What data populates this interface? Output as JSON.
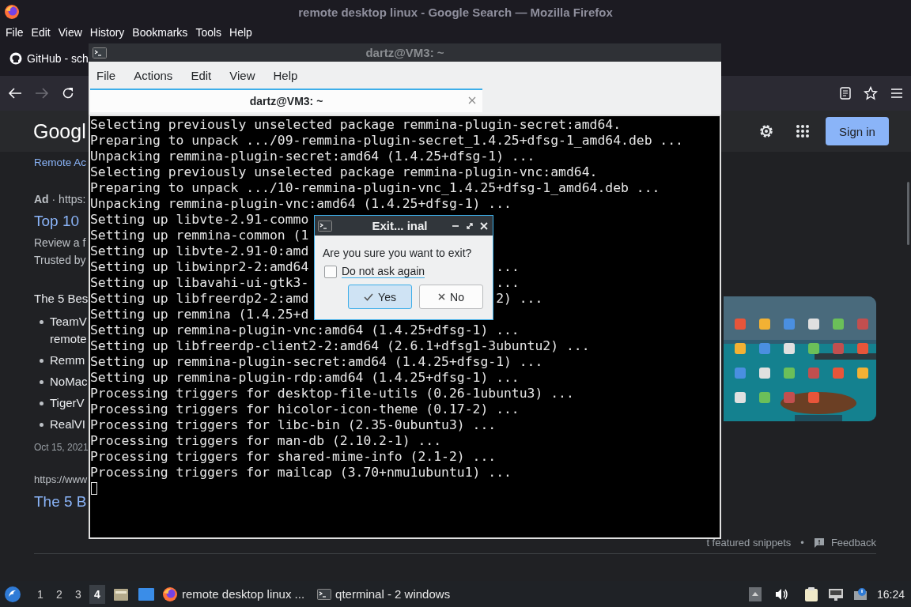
{
  "firefox": {
    "title": "remote desktop linux - Google Search — Mozilla Firefox",
    "menu": [
      "File",
      "Edit",
      "View",
      "History",
      "Bookmarks",
      "Tools",
      "Help"
    ],
    "tabs": [
      {
        "label": "GitHub - sch"
      }
    ],
    "nav": {
      "forward_disabled": true
    }
  },
  "google": {
    "logo": "Googl",
    "sign_in": "Sign in",
    "results": [
      {
        "kind": "link",
        "text": "Remote Ac"
      },
      {
        "kind": "ad",
        "text": "**Ad** · https:"
      },
      {
        "kind": "title",
        "text": "Top 10"
      },
      {
        "kind": "snippet",
        "text": "Review a f"
      },
      {
        "kind": "snippet",
        "text": "Trusted by"
      },
      {
        "kind": "heading",
        "text": "The 5 Bes"
      },
      {
        "kind": "bullet",
        "lines": [
          "TeamV",
          "remote"
        ]
      },
      {
        "kind": "bullet",
        "lines": [
          "Remm"
        ]
      },
      {
        "kind": "bullet",
        "lines": [
          "NoMac"
        ]
      },
      {
        "kind": "bullet",
        "lines": [
          "TigerV"
        ]
      },
      {
        "kind": "bullet",
        "lines": [
          "RealVI"
        ]
      },
      {
        "kind": "date",
        "text": "Oct 15, 2021"
      },
      {
        "kind": "url",
        "text": "https://www"
      },
      {
        "kind": "title",
        "text": "The 5 B"
      }
    ],
    "footer": {
      "snippets": "t featured snippets",
      "separator": "•",
      "feedback": "Feedback"
    }
  },
  "terminal": {
    "title": "dartz@VM3: ~",
    "menu": [
      "File",
      "Actions",
      "Edit",
      "View",
      "Help"
    ],
    "tab": "dartz@VM3: ~",
    "lines": [
      {
        "text": "Selecting previously unselected package remmina-plugin-secret:amd64."
      },
      {
        "text": "Preparing to unpack .../09-remmina-plugin-secret_1.4.25+dfsg-1_amd64.deb ..."
      },
      {
        "text": "Unpacking remmina-plugin-secret:amd64 (1.4.25+dfsg-1) ..."
      },
      {
        "text": "Selecting previously unselected package remmina-plugin-vnc:amd64."
      },
      {
        "text": "Preparing to unpack .../10-remmina-plugin-vnc_1.4.25+dfsg-1_amd64.deb ..."
      },
      {
        "text": "Unpacking remmina-plugin-vnc:amd64 (1.4.25+dfsg-1) ..."
      },
      {
        "text": "Setting up libvte-2.91-commo"
      },
      {
        "text": "Setting up remmina-common (1"
      },
      {
        "text": "Setting up libvte-2.91-0:amd"
      },
      {
        "text": "Setting up libwinpr2-2:amd64",
        "tail": "..."
      },
      {
        "text": "Setting up libavahi-ui-gtk3-",
        "tail": "..."
      },
      {
        "text": "Setting up libfreerdp2-2:amd",
        "tail": "2) ..."
      },
      {
        "text": "Setting up remmina (1.4.25+d"
      },
      {
        "text": "Setting up remmina-plugin-vnc:amd64 (1.4.25+dfsg-1) ..."
      },
      {
        "text": "Setting up libfreerdp-client2-2:amd64 (2.6.1+dfsg1-3ubuntu2) ..."
      },
      {
        "text": "Setting up remmina-plugin-secret:amd64 (1.4.25+dfsg-1) ..."
      },
      {
        "text": "Setting up remmina-plugin-rdp:amd64 (1.4.25+dfsg-1) ..."
      },
      {
        "text": "Processing triggers for desktop-file-utils (0.26-1ubuntu3) ..."
      },
      {
        "text": "Processing triggers for hicolor-icon-theme (0.17-2) ..."
      },
      {
        "text": "Processing triggers for libc-bin (2.35-0ubuntu3) ..."
      },
      {
        "text": "Processing triggers for man-db (2.10.2-1) ..."
      },
      {
        "text": "Processing triggers for shared-mime-info (2.1-2) ..."
      },
      {
        "text": "Processing triggers for mailcap (3.70+nmu1ubuntu1) ..."
      }
    ]
  },
  "dialog": {
    "title": "Exit... inal",
    "message": "Are you sure you want to exit?",
    "checkbox": {
      "label": "Do not ask again",
      "checked": false
    },
    "buttons": [
      {
        "label": "Yes",
        "kind": "yes",
        "default": true
      },
      {
        "label": "No",
        "kind": "no",
        "default": false
      }
    ]
  },
  "taskbar": {
    "desktops": [
      {
        "label": "1",
        "selected": false
      },
      {
        "label": "2",
        "selected": false
      },
      {
        "label": "3",
        "selected": false
      },
      {
        "label": "4",
        "selected": true
      }
    ],
    "tasks": [
      {
        "kind": "firefox",
        "label": "remote desktop linux ..."
      },
      {
        "kind": "terminal",
        "label": "qterminal - 2 windows"
      }
    ],
    "clock": "16:24"
  }
}
